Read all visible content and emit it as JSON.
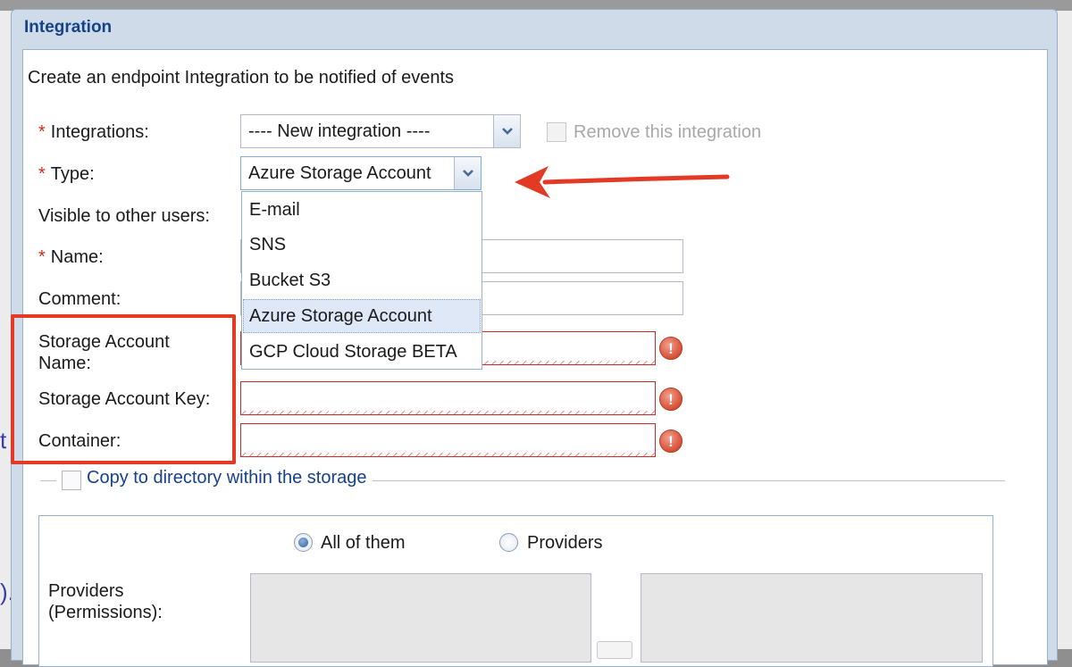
{
  "background": {
    "link_fragment_1": "t",
    "link_fragment_2": ")."
  },
  "dialog": {
    "title": "Integration",
    "intro": "Create an endpoint Integration to be notified of events"
  },
  "form": {
    "required_marker": "*",
    "integrations": {
      "label": "Integrations:",
      "value": "---- New integration ----",
      "remove_label": "Remove this integration"
    },
    "type": {
      "label": "Type:",
      "value": "Azure Storage Account",
      "options": [
        "E-mail",
        "SNS",
        "Bucket S3",
        "Azure Storage Account",
        "GCP Cloud Storage BETA"
      ],
      "selected_index": 3
    },
    "visible_label": "Visible to other users:",
    "name_label": "Name:",
    "comment_label": "Comment:",
    "storage_account_name_label": "Storage Account Name:",
    "storage_account_key_label": "Storage Account Key:",
    "container_label": "Container:",
    "copy_dir_label": "Copy to directory within the storage"
  },
  "permissions": {
    "radio_all_label": "All of them",
    "radio_providers_label": "Providers",
    "selected": "all",
    "providers_label": "Providers (Permissions):"
  },
  "colors": {
    "accent": "#15428b",
    "required": "#d0291b",
    "annotation": "#e23a24",
    "invalid_border": "#cc2b2b"
  },
  "icons": {
    "combo_trigger": "chevron-down-icon",
    "field_error": "exclamation-icon",
    "annotation": "arrow-left-icon"
  }
}
